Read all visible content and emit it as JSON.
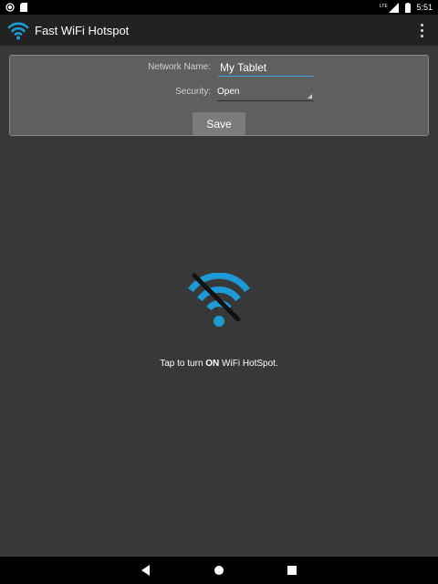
{
  "status_bar": {
    "clock": "5:51",
    "network_label": "LTE",
    "icons": [
      "record-icon",
      "sd-card-icon",
      "lte-signal-icon",
      "battery-icon"
    ]
  },
  "app_bar": {
    "title": "Fast WiFi Hotspot",
    "logo_icon": "wifi-icon",
    "menu_icon": "overflow-menu-icon"
  },
  "settings": {
    "network_name_label": "Network Name:",
    "network_name_value": "My Tablet",
    "security_label": "Security:",
    "security_value": "Open",
    "save_label": "Save"
  },
  "hotspot": {
    "state_icon": "wifi-off-icon",
    "instruction_prefix": "Tap to turn ",
    "instruction_emphasis": "ON",
    "instruction_suffix": " WiFi HotSpot."
  },
  "nav_bar": {
    "icons": [
      "back-icon",
      "home-icon",
      "recents-icon"
    ]
  },
  "colors": {
    "accent": "#1e9ad6",
    "background": "#383838",
    "app_bar": "#222222",
    "panel": "#5f5f5f",
    "save_button": "#7b7b7b"
  }
}
